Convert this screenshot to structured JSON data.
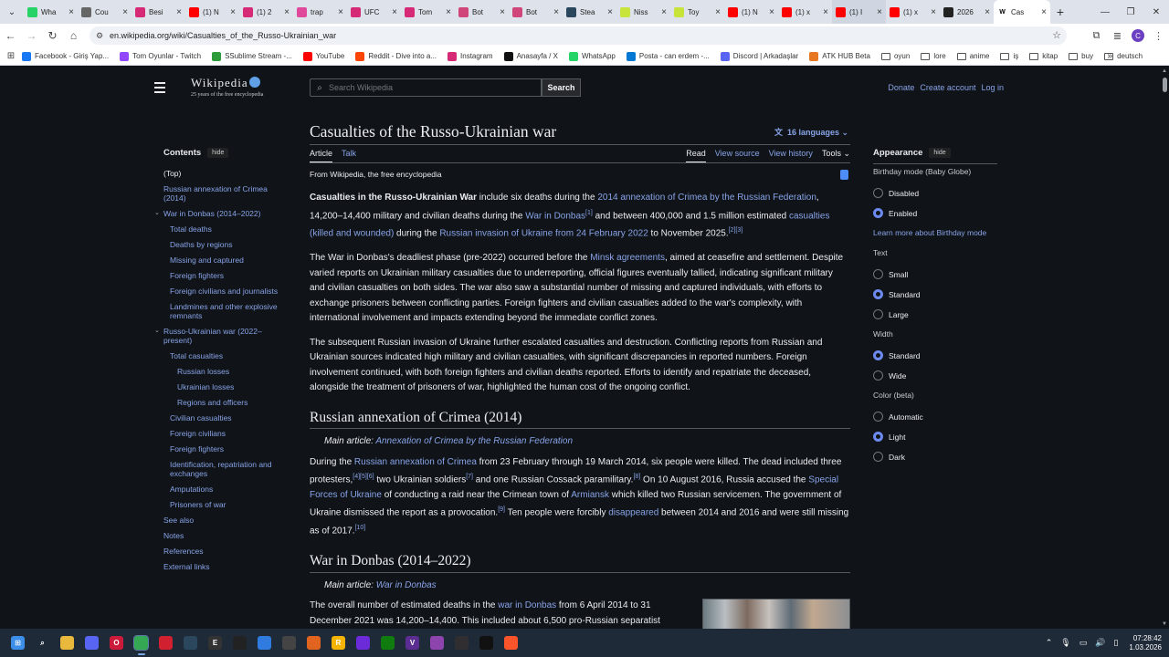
{
  "browser": {
    "tabs": [
      {
        "title": "Wha",
        "icon": "whatsapp-icon",
        "color": "#25d366"
      },
      {
        "title": "Cou",
        "icon": "globe-icon",
        "color": "#666666"
      },
      {
        "title": "Besi",
        "icon": "instagram-icon",
        "color": "#d62976"
      },
      {
        "title": "(1) N",
        "icon": "youtube-icon",
        "color": "#ff0000"
      },
      {
        "title": "(1) 2",
        "icon": "instagram-icon",
        "color": "#d62976"
      },
      {
        "title": "trap",
        "icon": "ring-icon",
        "color": "#e0489a"
      },
      {
        "title": "UFC",
        "icon": "instagram-icon",
        "color": "#d62976"
      },
      {
        "title": "Tom",
        "icon": "instagram-icon",
        "color": "#d62976"
      },
      {
        "title": "Bot",
        "icon": "b-icon",
        "color": "#d0457a"
      },
      {
        "title": "Bot",
        "icon": "b-icon",
        "color": "#d0457a"
      },
      {
        "title": "Stea",
        "icon": "steam-icon",
        "color": "#2a475e"
      },
      {
        "title": "Niss",
        "icon": "s-icon",
        "color": "#c8e33a"
      },
      {
        "title": "Toy",
        "icon": "s-icon",
        "color": "#c8e33a"
      },
      {
        "title": "(1) N",
        "icon": "youtube-icon",
        "color": "#ff0000"
      },
      {
        "title": "(1) x",
        "icon": "youtube-icon",
        "color": "#ff0000"
      },
      {
        "title": "(1) I",
        "icon": "youtube-icon",
        "color": "#ff0000"
      },
      {
        "title": "(1) x",
        "icon": "youtube-icon",
        "color": "#ff0000"
      },
      {
        "title": "2026",
        "icon": "nyt-icon",
        "color": "#222222"
      },
      {
        "title": "Cas",
        "icon": "wikipedia-icon",
        "color": "#ffffff"
      }
    ],
    "url": "en.wikipedia.org/wiki/Casualties_of_the_Russo-Ukrainian_war",
    "bookmarks": [
      {
        "label": "Facebook - Giriş Yap...",
        "icon": "facebook-icon",
        "color": "#1877f2",
        "folder": false
      },
      {
        "label": "Tom Oyunlar - Twitch",
        "icon": "twitch-icon",
        "color": "#9146ff",
        "folder": false
      },
      {
        "label": "SSublime Stream -...",
        "icon": "sublime-icon",
        "color": "#2e9c3a",
        "folder": false
      },
      {
        "label": "YouTube",
        "icon": "youtube-icon",
        "color": "#ff0000",
        "folder": false
      },
      {
        "label": "Reddit - Dive into a...",
        "icon": "reddit-icon",
        "color": "#ff4500",
        "folder": false
      },
      {
        "label": "Instagram",
        "icon": "instagram-icon",
        "color": "#d62976",
        "folder": false
      },
      {
        "label": "Anasayfa / X",
        "icon": "x-icon",
        "color": "#111111",
        "folder": false
      },
      {
        "label": "WhatsApp",
        "icon": "whatsapp-icon",
        "color": "#25d366",
        "folder": false
      },
      {
        "label": "Posta - can erdem -...",
        "icon": "outlook-icon",
        "color": "#0078d4",
        "folder": false
      },
      {
        "label": "Discord | Arkadaşlar",
        "icon": "discord-icon",
        "color": "#5865f2",
        "folder": false
      },
      {
        "label": "ATK HUB Beta",
        "icon": "atk-icon",
        "color": "#e87722",
        "folder": false
      },
      {
        "label": "oyun",
        "icon": "folder-icon",
        "color": "",
        "folder": true
      },
      {
        "label": "lore",
        "icon": "folder-icon",
        "color": "",
        "folder": true
      },
      {
        "label": "anime",
        "icon": "folder-icon",
        "color": "",
        "folder": true
      },
      {
        "label": "iş",
        "icon": "folder-icon",
        "color": "",
        "folder": true
      },
      {
        "label": "kitap",
        "icon": "folder-icon",
        "color": "",
        "folder": true
      },
      {
        "label": "buy",
        "icon": "folder-icon",
        "color": "",
        "folder": true
      },
      {
        "label": "deutsch",
        "icon": "folder-icon",
        "color": "",
        "folder": true
      }
    ],
    "bookmark_overflow": "»",
    "profile_initial": "C"
  },
  "wiki": {
    "wordmark": "Wikipedia",
    "tagline": "25 years of the free encyclopedia",
    "search_placeholder": "Search Wikipedia",
    "search_button": "Search",
    "personal": [
      "Donate",
      "Create account",
      "Log in"
    ],
    "title": "Casualties of the Russo-Ukrainian war",
    "languages": "16 languages",
    "tabs_left": [
      "Article",
      "Talk"
    ],
    "tabs_right": [
      "Read",
      "View source",
      "View history",
      "Tools"
    ],
    "from": "From Wikipedia, the free encyclopedia",
    "toc": {
      "heading": "Contents",
      "hide": "hide",
      "items": [
        {
          "label": "(Top)",
          "level": 1,
          "chevron": false
        },
        {
          "label": "Russian annexation of Crimea (2014)",
          "level": 1,
          "chevron": false
        },
        {
          "label": "War in Donbas (2014–2022)",
          "level": 1,
          "chevron": true
        },
        {
          "label": "Total deaths",
          "level": 2,
          "chevron": false
        },
        {
          "label": "Deaths by regions",
          "level": 2,
          "chevron": false
        },
        {
          "label": "Missing and captured",
          "level": 2,
          "chevron": false
        },
        {
          "label": "Foreign fighters",
          "level": 2,
          "chevron": false
        },
        {
          "label": "Foreign civilians and journalists",
          "level": 2,
          "chevron": false
        },
        {
          "label": "Landmines and other explosive remnants",
          "level": 2,
          "chevron": false
        },
        {
          "label": "Russo-Ukrainian war (2022–present)",
          "level": 1,
          "chevron": true
        },
        {
          "label": "Total casualties",
          "level": 2,
          "chevron": false
        },
        {
          "label": "Russian losses",
          "level": 3,
          "chevron": false
        },
        {
          "label": "Ukrainian losses",
          "level": 3,
          "chevron": false
        },
        {
          "label": "Regions and officers",
          "level": 3,
          "chevron": false
        },
        {
          "label": "Civilian casualties",
          "level": 2,
          "chevron": false
        },
        {
          "label": "Foreign civilians",
          "level": 2,
          "chevron": false
        },
        {
          "label": "Foreign fighters",
          "level": 2,
          "chevron": false
        },
        {
          "label": "Identification, repatriation and exchanges",
          "level": 2,
          "chevron": false
        },
        {
          "label": "Amputations",
          "level": 2,
          "chevron": false
        },
        {
          "label": "Prisoners of war",
          "level": 2,
          "chevron": false
        },
        {
          "label": "See also",
          "level": 1,
          "chevron": false
        },
        {
          "label": "Notes",
          "level": 1,
          "chevron": false
        },
        {
          "label": "References",
          "level": 1,
          "chevron": false
        },
        {
          "label": "External links",
          "level": 1,
          "chevron": false
        }
      ]
    },
    "body": {
      "p1": [
        {
          "b": "Casualties in the Russo-Ukrainian War"
        },
        {
          "t": " include six deaths during the "
        },
        {
          "a": "2014 annexation of Crimea by the Russian Federation"
        },
        {
          "t": ", 14,200–14,400 military and civilian deaths during the "
        },
        {
          "a": "War in Donbas"
        },
        {
          "s": "[1]"
        },
        {
          "t": " and between 400,000 and 1.5 million estimated "
        },
        {
          "a": "casualties (killed and wounded)"
        },
        {
          "t": " during the "
        },
        {
          "a": "Russian invasion of Ukraine from 24 February 2022"
        },
        {
          "t": " to November 2025."
        },
        {
          "s": "[2][3]"
        }
      ],
      "p2": [
        {
          "t": "The War in Donbas's deadliest phase (pre-2022) occurred before the "
        },
        {
          "a": "Minsk agreements"
        },
        {
          "t": ", aimed at ceasefire and settlement. Despite varied reports on Ukrainian military casualties due to underreporting, official figures eventually tallied, indicating significant military and civilian casualties on both sides. The war also saw a substantial number of missing and captured individuals, with efforts to exchange prisoners between conflicting parties. Foreign fighters and civilian casualties added to the war's complexity, with international involvement and impacts extending beyond the immediate conflict zones."
        }
      ],
      "p3": [
        {
          "t": "The subsequent Russian invasion of Ukraine further escalated casualties and destruction. Conflicting reports from Russian and Ukrainian sources indicated high military and civilian casualties, with significant discrepancies in reported numbers. Foreign involvement continued, with both foreign fighters and civilian deaths reported. Efforts to identify and repatriate the deceased, alongside the treatment of prisoners of war, highlighted the human cost of the ongoing conflict."
        }
      ],
      "h_crimea": "Russian annexation of Crimea (2014)",
      "hat_crimea_prefix": "Main article: ",
      "hat_crimea_link": "Annexation of Crimea by the Russian Federation",
      "p4": [
        {
          "t": "During the "
        },
        {
          "a": "Russian annexation of Crimea"
        },
        {
          "t": " from 23 February through 19 March 2014, six people were killed. The dead included three protesters,"
        },
        {
          "s": "[4][5][6]"
        },
        {
          "t": " two Ukrainian soldiers"
        },
        {
          "s": "[7]"
        },
        {
          "t": " and one Russian Cossack paramilitary."
        },
        {
          "s": "[8]"
        },
        {
          "t": " On 10 August 2016, Russia accused the "
        },
        {
          "a": "Special Forces of Ukraine"
        },
        {
          "t": " of conducting a raid near the Crimean town of "
        },
        {
          "a": "Armiansk"
        },
        {
          "t": " which killed two Russian servicemen. The government of Ukraine dismissed the report as a provocation."
        },
        {
          "s": "[9]"
        },
        {
          "t": " Ten people were forcibly "
        },
        {
          "a": "disappeared"
        },
        {
          "t": " between 2014 and 2016 and were still missing as of 2017."
        },
        {
          "s": "[10]"
        }
      ],
      "h_donbas": "War in Donbas (2014–2022)",
      "hat_donbas_prefix": "Main article: ",
      "hat_donbas_link": "War in Donbas",
      "p5": [
        {
          "t": "The overall number of estimated deaths in the "
        },
        {
          "a": "war in Donbas"
        },
        {
          "t": " from 6 April 2014 to 31 December 2021 was 14,200–14,400. This included about 6,500 pro-Russian separatist fighters, 4,400 Ukrainian fighters, and 3,404 civilians."
        },
        {
          "s": "[1]"
        },
        {
          "t": " This number includes non-combat"
        }
      ]
    },
    "appearance": {
      "heading": "Appearance",
      "hide": "hide",
      "birthday_label": "Birthday mode (Baby Globe)",
      "birthday_options": [
        {
          "label": "Disabled",
          "on": false
        },
        {
          "label": "Enabled",
          "on": true
        }
      ],
      "birthday_link": "Learn more about Birthday mode",
      "text_label": "Text",
      "text_options": [
        {
          "label": "Small",
          "on": false
        },
        {
          "label": "Standard",
          "on": true
        },
        {
          "label": "Large",
          "on": false
        }
      ],
      "width_label": "Width",
      "width_options": [
        {
          "label": "Standard",
          "on": true
        },
        {
          "label": "Wide",
          "on": false
        }
      ],
      "color_label": "Color (beta)",
      "color_options": [
        {
          "label": "Automatic",
          "on": false
        },
        {
          "label": "Light",
          "on": true
        },
        {
          "label": "Dark",
          "on": false
        }
      ]
    }
  },
  "taskbar": {
    "apps": [
      {
        "name": "windows-start-icon",
        "color": "#3c8ee8",
        "glyph": "⊞",
        "active": false
      },
      {
        "name": "search-icon",
        "color": "#1f2a38",
        "glyph": "⌕",
        "active": false
      },
      {
        "name": "file-explorer-icon",
        "color": "#e8b93c",
        "glyph": "",
        "active": false
      },
      {
        "name": "discord-icon",
        "color": "#5865f2",
        "glyph": "",
        "active": false
      },
      {
        "name": "opera-icon",
        "color": "#cc1b3a",
        "glyph": "O",
        "active": false
      },
      {
        "name": "chrome-icon",
        "color": "#34a853",
        "glyph": "",
        "active": true
      },
      {
        "name": "app-red-icon",
        "color": "#d1202f",
        "glyph": "",
        "active": false
      },
      {
        "name": "steam-icon",
        "color": "#2a475e",
        "glyph": "",
        "active": false
      },
      {
        "name": "epic-games-icon",
        "color": "#333333",
        "glyph": "E",
        "active": false
      },
      {
        "name": "terminal-icon",
        "color": "#222222",
        "glyph": "",
        "active": false
      },
      {
        "name": "app-blue-icon",
        "color": "#2f7be0",
        "glyph": "",
        "active": false
      },
      {
        "name": "app-ring-icon",
        "color": "#444444",
        "glyph": "",
        "active": false
      },
      {
        "name": "app-orange-icon",
        "color": "#e0641f",
        "glyph": "",
        "active": false
      },
      {
        "name": "rockstar-icon",
        "color": "#f4b400",
        "glyph": "R",
        "active": false
      },
      {
        "name": "app-purple-icon",
        "color": "#6c2bd9",
        "glyph": "",
        "active": false
      },
      {
        "name": "xbox-icon",
        "color": "#107c10",
        "glyph": "",
        "active": false
      },
      {
        "name": "vs-icon",
        "color": "#5c2d91",
        "glyph": "V",
        "active": false
      },
      {
        "name": "app-violet-icon",
        "color": "#8e44ad",
        "glyph": "",
        "active": false
      },
      {
        "name": "obs-icon",
        "color": "#302e31",
        "glyph": "",
        "active": false
      },
      {
        "name": "app-dark-icon",
        "color": "#111111",
        "glyph": "",
        "active": false
      },
      {
        "name": "brave-icon",
        "color": "#fb542b",
        "glyph": "",
        "active": false
      }
    ],
    "time": "07:28:42",
    "date": "1.03.2026"
  }
}
